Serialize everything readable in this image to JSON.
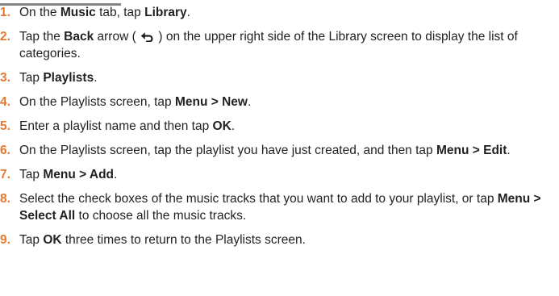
{
  "steps": [
    {
      "number": "1.",
      "parts": [
        {
          "t": "On the "
        },
        {
          "t": "Music",
          "bold": true
        },
        {
          "t": " tab, tap "
        },
        {
          "t": "Library",
          "bold": true
        },
        {
          "t": "."
        }
      ]
    },
    {
      "number": "2.",
      "parts": [
        {
          "t": "Tap the "
        },
        {
          "t": "Back",
          "bold": true
        },
        {
          "t": " arrow ( "
        },
        {
          "icon": "back-arrow-icon"
        },
        {
          "t": " ) on the upper right side of the Library screen to display the list of categories."
        }
      ]
    },
    {
      "number": "3.",
      "parts": [
        {
          "t": "Tap "
        },
        {
          "t": "Playlists",
          "bold": true
        },
        {
          "t": "."
        }
      ]
    },
    {
      "number": "4.",
      "parts": [
        {
          "t": "On the Playlists screen, tap "
        },
        {
          "t": "Menu > New",
          "bold": true
        },
        {
          "t": "."
        }
      ]
    },
    {
      "number": "5.",
      "parts": [
        {
          "t": "Enter a playlist name and then tap "
        },
        {
          "t": "OK",
          "bold": true
        },
        {
          "t": "."
        }
      ]
    },
    {
      "number": "6.",
      "parts": [
        {
          "t": "On the Playlists screen, tap the playlist you have just created, and then tap "
        },
        {
          "t": "Menu > Edit",
          "bold": true
        },
        {
          "t": "."
        }
      ]
    },
    {
      "number": "7.",
      "parts": [
        {
          "t": "Tap "
        },
        {
          "t": "Menu > Add",
          "bold": true
        },
        {
          "t": "."
        }
      ]
    },
    {
      "number": "8.",
      "parts": [
        {
          "t": "Select the check boxes of the music tracks that you want to add to your playlist, or tap "
        },
        {
          "t": "Menu > Select All",
          "bold": true
        },
        {
          "t": " to choose all the music tracks."
        }
      ]
    },
    {
      "number": "9.",
      "parts": [
        {
          "t": "Tap "
        },
        {
          "t": "OK",
          "bold": true
        },
        {
          "t": " three times to return to the Playlists screen."
        }
      ]
    }
  ],
  "colors": {
    "step_number": "#e8772e",
    "text": "#231f20"
  }
}
